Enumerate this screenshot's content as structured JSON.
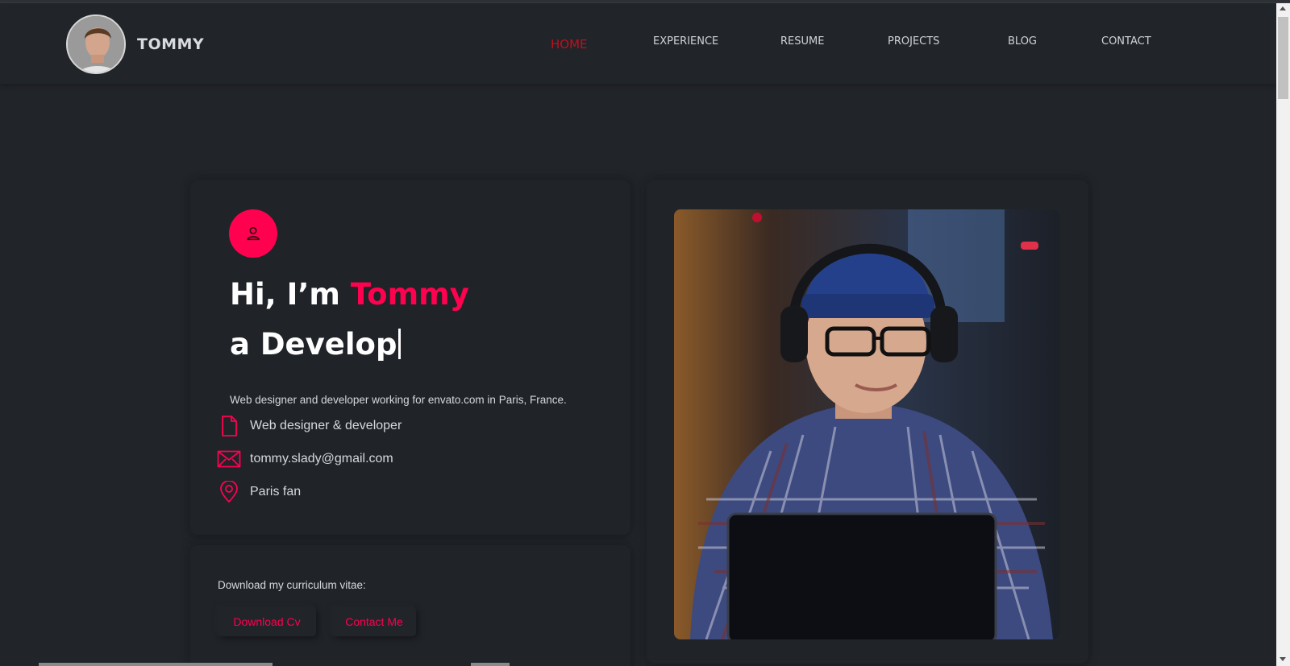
{
  "header": {
    "brand": "TOMMY",
    "nav": [
      {
        "label": "HOME",
        "active": true
      },
      {
        "label": "EXPERIENCE",
        "active": false
      },
      {
        "label": "RESUME",
        "active": false
      },
      {
        "label": "PROJECTS",
        "active": false
      },
      {
        "label": "BLOG",
        "active": false
      },
      {
        "label": "CONTACT",
        "active": false
      }
    ]
  },
  "hero": {
    "greeting_prefix": "Hi, I’m ",
    "name": "Tommy",
    "typed_role": "a Develop",
    "bio": "Web designer and developer working for envato.com in Paris, France.",
    "info": [
      {
        "icon": "document-icon",
        "text": "Web designer & developer"
      },
      {
        "icon": "mail-icon",
        "text": "tommy.slady@gmail.com"
      },
      {
        "icon": "location-pin-icon",
        "text": "Paris fan"
      }
    ]
  },
  "cv": {
    "label": "Download my curriculum vitae:",
    "download_button": "Download Cv",
    "contact_button": "Contact Me"
  },
  "colors": {
    "background": "#212429",
    "accent": "#ff014f",
    "nav_active": "#c1101e",
    "text": "#d6d8dc"
  }
}
